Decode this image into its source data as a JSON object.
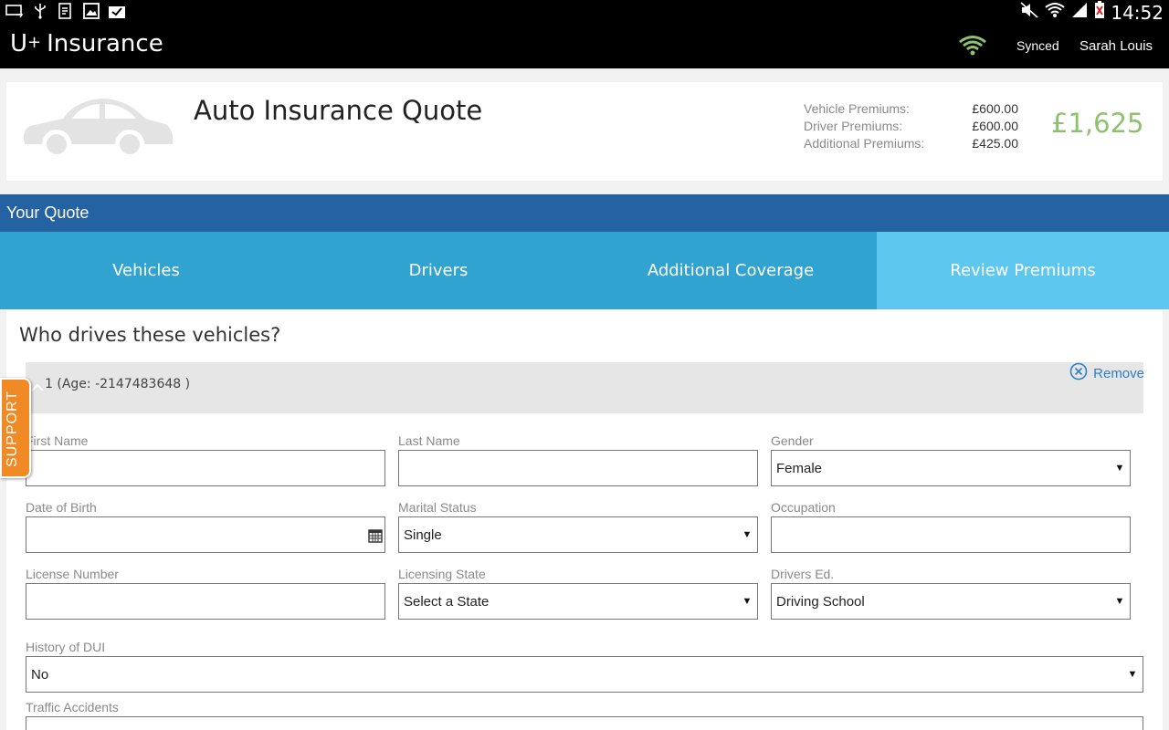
{
  "status_bar": {
    "time": "14:52"
  },
  "app": {
    "logo": "U",
    "logo_plus": "+",
    "title": "Insurance",
    "sync_status": "Synced",
    "user": "Sarah Louis",
    "accent": "#8dc26f"
  },
  "quote": {
    "title": "Auto Insurance Quote",
    "premiums": [
      {
        "label": "Vehicle Premiums:",
        "value": "£600.00"
      },
      {
        "label": "Driver Premiums:",
        "value": "£600.00"
      },
      {
        "label": "Additional Premiums:",
        "value": "£425.00"
      }
    ],
    "total": "£1,625"
  },
  "section": {
    "title": "Your Quote"
  },
  "tabs": [
    {
      "label": "Vehicles",
      "active": false
    },
    {
      "label": "Drivers",
      "active": false
    },
    {
      "label": "Additional Coverage",
      "active": false
    },
    {
      "label": "Review Premiums",
      "active": true
    }
  ],
  "form": {
    "question": "Who drives these vehicles?",
    "driver_label": "1 (Age: -2147483648 )",
    "remove_label": "Remove",
    "first_name": {
      "label": "First Name",
      "value": ""
    },
    "last_name": {
      "label": "Last Name",
      "value": ""
    },
    "gender": {
      "label": "Gender",
      "value": "Female"
    },
    "dob": {
      "label": "Date of Birth",
      "value": ""
    },
    "marital": {
      "label": "Marital Status",
      "value": "Single"
    },
    "occupation": {
      "label": "Occupation",
      "value": ""
    },
    "license": {
      "label": "License Number",
      "value": ""
    },
    "licensing_state": {
      "label": "Licensing State",
      "value": "Select a State"
    },
    "drivers_ed": {
      "label": "Drivers Ed.",
      "value": "Driving School"
    },
    "dui": {
      "label": "History of DUI",
      "value": "No"
    },
    "accidents": {
      "label": "Traffic Accidents",
      "value": ""
    }
  },
  "support_label": "SUPPORT"
}
